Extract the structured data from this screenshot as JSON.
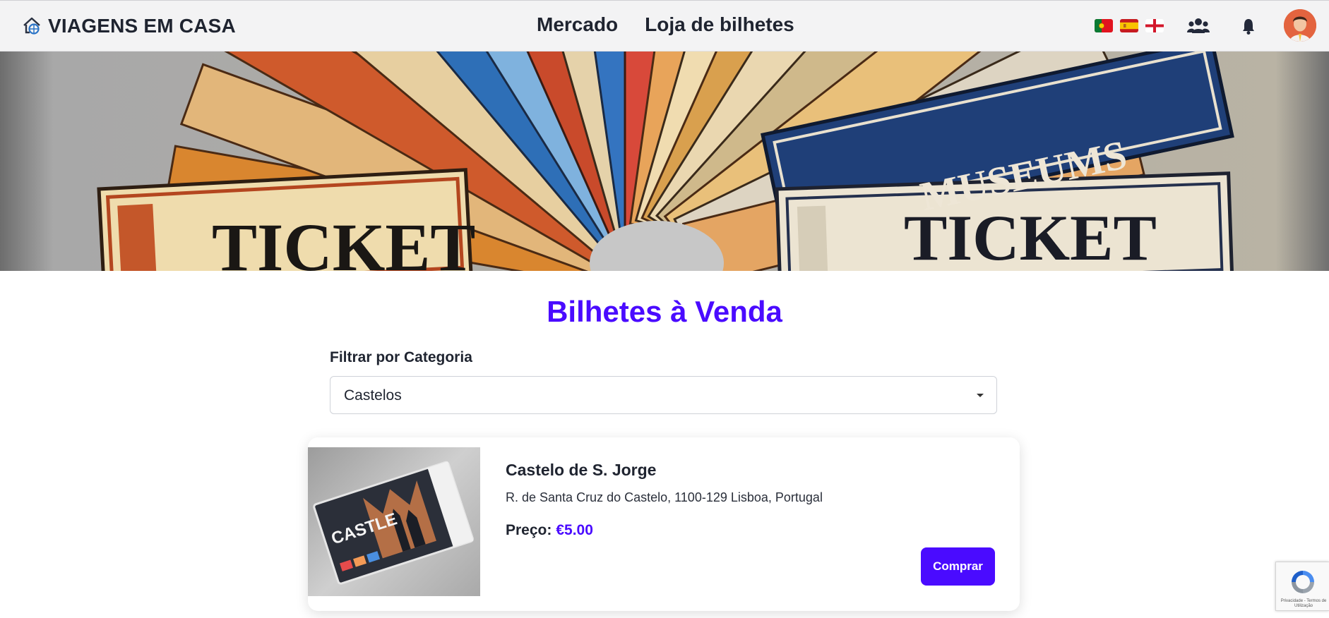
{
  "header": {
    "brand": "VIAGENS EM CASA",
    "nav": [
      "Mercado",
      "Loja de bilhetes"
    ],
    "languages": [
      "pt-flag-icon",
      "es-flag-icon",
      "en-flag-icon"
    ],
    "icons": [
      "users-icon",
      "bell-icon"
    ]
  },
  "hero": {
    "ticket_left": "TICKET",
    "ticket_right": "TICKET",
    "museum_ticket": "MUSEUMS"
  },
  "main": {
    "title": "Bilhetes à Venda",
    "filter_label": "Filtrar por Categoria",
    "filter_value": "Castelos"
  },
  "card": {
    "thumb_text": "CASTLE",
    "name": "Castelo de S. Jorge",
    "address": "R. de Santa Cruz do Castelo, 1100-129 Lisboa, Portugal",
    "price_label": "Preço:",
    "price_value": "€5.00",
    "buy_label": "Comprar"
  },
  "recaptcha": {
    "links": "Privacidade - Termos de Utilização"
  },
  "colors": {
    "accent": "#4a0bff",
    "header_bg": "#f3f3f4",
    "text": "#1f2430"
  }
}
